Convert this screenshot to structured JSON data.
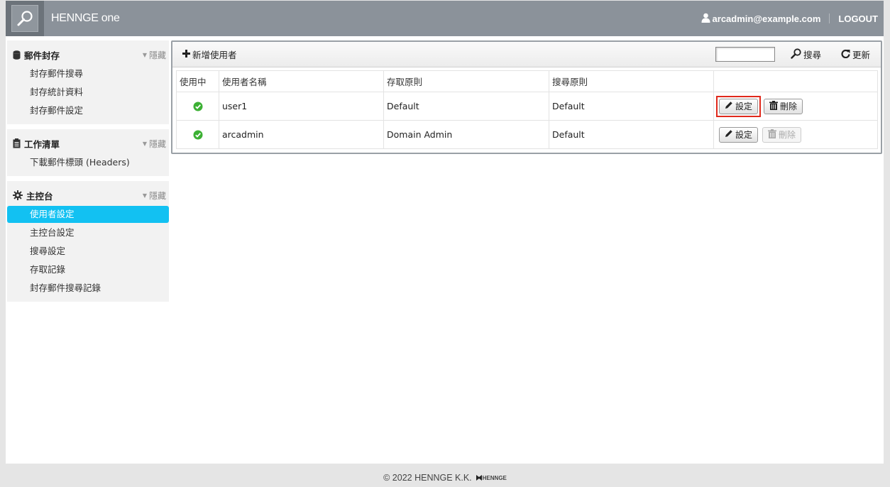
{
  "header": {
    "brand": "HENNGE one",
    "user": "arcadmin@example.com",
    "logout": "LOGOUT"
  },
  "sidebar": {
    "hide_label": "隱藏",
    "sections": [
      {
        "title": "郵件封存",
        "icon": "database-icon",
        "items": [
          "封存郵件搜尋",
          "封存統計資料",
          "封存郵件設定"
        ]
      },
      {
        "title": "工作清單",
        "icon": "clipboard-icon",
        "items": [
          "下載郵件標頭 (Headers)"
        ]
      },
      {
        "title": "主控台",
        "icon": "gear-icon",
        "items": [
          "使用者設定",
          "主控台設定",
          "搜尋設定",
          "存取記錄",
          "封存郵件搜尋記錄"
        ]
      }
    ]
  },
  "toolbar": {
    "add_user": "新增使用者",
    "search": "搜尋",
    "refresh": "更新",
    "search_value": ""
  },
  "table": {
    "headers": [
      "使用中",
      "使用者名稱",
      "存取原則",
      "搜尋原則",
      ""
    ],
    "rows": [
      {
        "active": true,
        "name": "user1",
        "access": "Default",
        "search": "Default",
        "delete_enabled": true
      },
      {
        "active": true,
        "name": "arcadmin",
        "access": "Domain Admin",
        "search": "Default",
        "delete_enabled": false
      }
    ],
    "settings_label": "設定",
    "delete_label": "刪除"
  },
  "footer": {
    "copyright": "© 2022 HENNGE K.K.",
    "logo_text": "HENNGE"
  },
  "colors": {
    "header_bg": "#8b929a",
    "active_item": "#12c1f2",
    "highlight": "#e0291c",
    "check": "#3cb034"
  }
}
